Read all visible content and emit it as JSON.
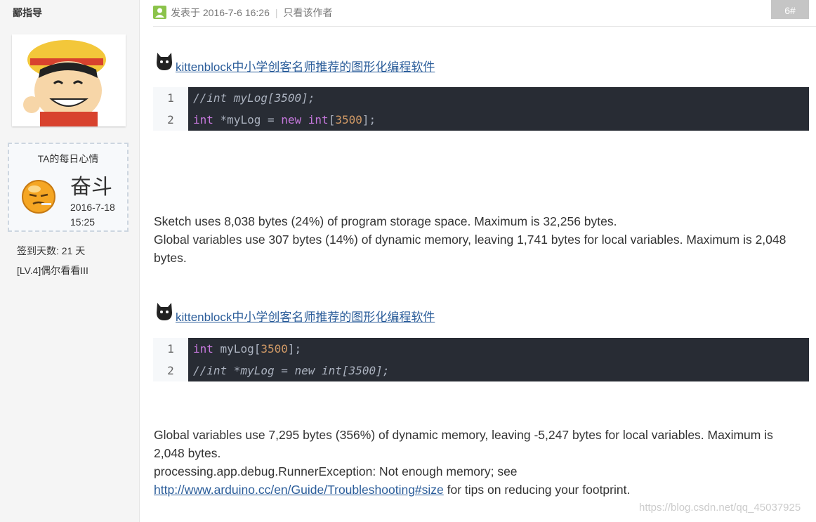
{
  "sidebar": {
    "username": "鄙指导",
    "mood_title": "TA的每日心情",
    "mood_word": "奋斗",
    "mood_date_line1": "2016-7-18",
    "mood_date_line2": "15:25",
    "signin_days": "签到天数: 21 天",
    "level": "[LV.4]偶尔看看III"
  },
  "post": {
    "meta_date": "发表于 2016-7-6 16:26",
    "only_author": "只看该作者",
    "floor": "6#"
  },
  "ad1": {
    "link": "kittenblock中小学创客名师推荐的图形化编程软件"
  },
  "code1": {
    "ln1": "1",
    "ln2": "2",
    "line1": "//int myLog[3500];",
    "line2_kw1": "int",
    "line2_mid": " *myLog = ",
    "line2_kw2": "new",
    "line2_sp": " ",
    "line2_kw3": "int",
    "line2_br1": "[",
    "line2_num": "3500",
    "line2_br2": "];"
  },
  "para1": {
    "l1": "Sketch uses 8,038 bytes (24%) of program storage space. Maximum is 32,256 bytes.",
    "l2": "Global variables use 307 bytes (14%) of dynamic memory, leaving 1,741 bytes for local variables. Maximum is 2,048 bytes."
  },
  "ad2": {
    "link": "kittenblock中小学创客名师推荐的图形化编程软件"
  },
  "code2": {
    "ln1": "1",
    "ln2": "2",
    "line1_kw": "int",
    "line1_mid": " myLog[",
    "line1_num": "3500",
    "line1_end": "];",
    "line2": "//int *myLog = new int[3500];"
  },
  "para2": {
    "l1": "Global variables use 7,295 bytes (356%) of dynamic memory, leaving -5,247 bytes for local variables. Maximum is 2,048 bytes.",
    "l2": "processing.app.debug.RunnerException: Not enough memory; see",
    "link": "http://www.arduino.cc/en/Guide/Troubleshooting#size",
    "l3_rest": " for tips on reducing your footprint."
  },
  "watermark": "https://blog.csdn.net/qq_45037925",
  "colors": {
    "link": "#2b5d9a",
    "code_bg": "#282c34",
    "keyword": "#c678dd",
    "number": "#d19a66"
  }
}
